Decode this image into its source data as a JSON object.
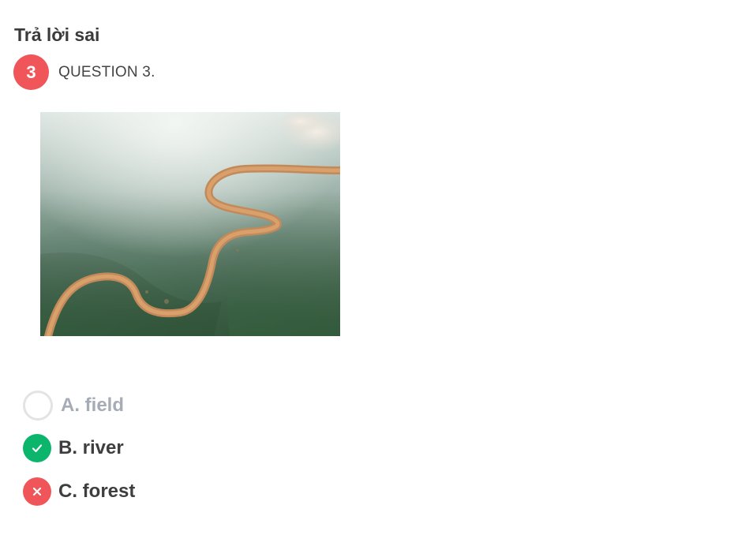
{
  "result": {
    "title": "Trả lời sai"
  },
  "question": {
    "number": "3",
    "label": "QUESTION 3."
  },
  "colors": {
    "wrong": "#f0555a",
    "correct": "#0bb56c",
    "muted_text": "#a6acb6",
    "dark_text": "#3e3e3e"
  },
  "options": [
    {
      "text": "A. field",
      "state": "unselected"
    },
    {
      "text": "B. river",
      "state": "correct",
      "icon": "check-icon"
    },
    {
      "text": "C. forest",
      "state": "wrong",
      "icon": "cross-icon"
    }
  ]
}
